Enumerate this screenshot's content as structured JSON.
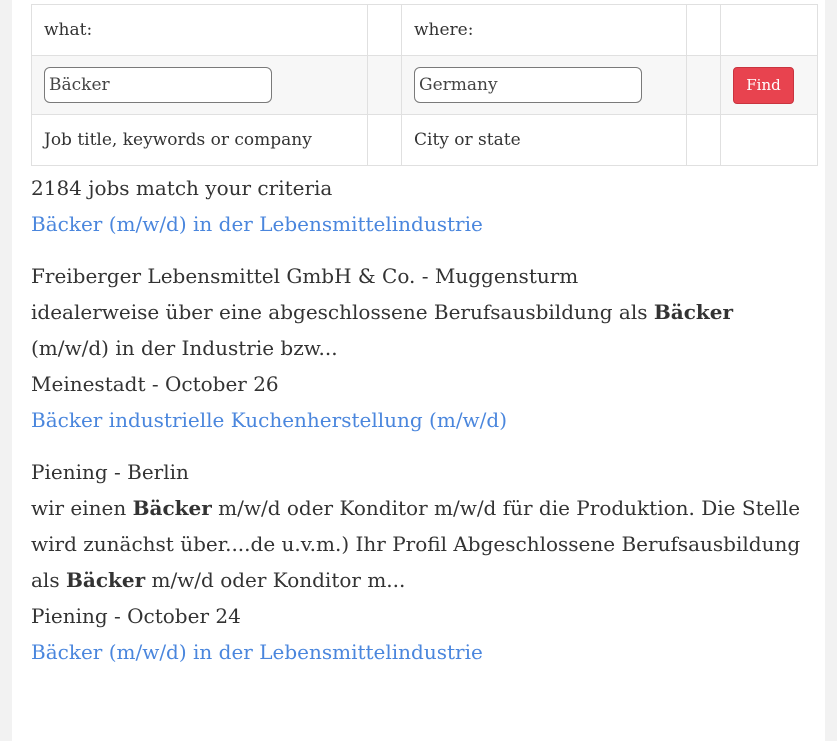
{
  "search": {
    "what_label": "what:",
    "where_label": "where:",
    "what_value": "Bäcker",
    "where_value": "Germany",
    "find_label": "Find",
    "what_hint": "Job title, keywords or company",
    "where_hint": "City or state"
  },
  "results": {
    "count_text": "2184 jobs match your criteria",
    "jobs": [
      {
        "title": "Bäcker (m/w/d) in der Lebensmittelindustrie",
        "company_location": "Freiberger Lebensmittel GmbH & Co. - Muggensturm",
        "snippet_parts": [
          "idealerweise über eine abgeschlossene Berufsausbildung als ",
          "Bäcker",
          " (m/w/d) in der Industrie bzw..."
        ],
        "source_date": "Meinestadt - October 26"
      },
      {
        "title": "Bäcker industrielle Kuchenherstellung (m/w/d)",
        "company_location": "Piening - Berlin",
        "snippet_parts": [
          "wir einen ",
          "Bäcker",
          " m/w/d oder Konditor m/w/d für die Produktion. Die Stelle wird zunächst über....de u.v.m.) Ihr Profil Abgeschlossene Berufsausbildung als ",
          "Bäcker",
          " m/w/d oder Konditor m..."
        ],
        "source_date": "Piening - October 24"
      },
      {
        "title": "Bäcker (m/w/d) in der Lebensmittelindustrie"
      }
    ]
  }
}
